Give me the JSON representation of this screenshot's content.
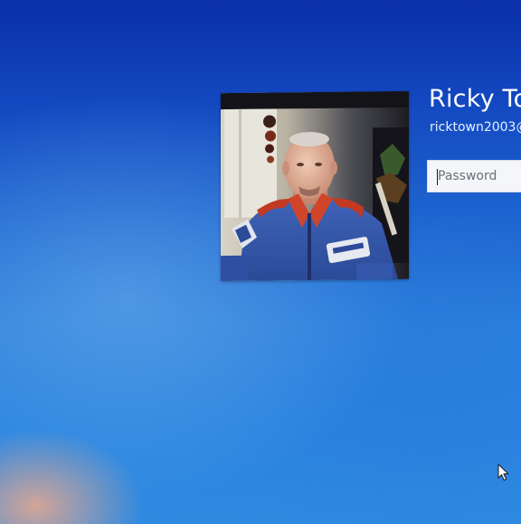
{
  "lock_screen": {
    "user": {
      "name": "Ricky To",
      "account": "ricktown2003@"
    },
    "password": {
      "placeholder": "Password",
      "value": ""
    },
    "avatar": {
      "icon": "user-photo"
    },
    "pointer": {
      "icon": "arrow-cursor-icon"
    },
    "colors": {
      "background_top": "#0a2fa9",
      "background_bottom": "#2f8ae0",
      "text": "#ffffff",
      "field_background": "#f4f6f9"
    }
  }
}
